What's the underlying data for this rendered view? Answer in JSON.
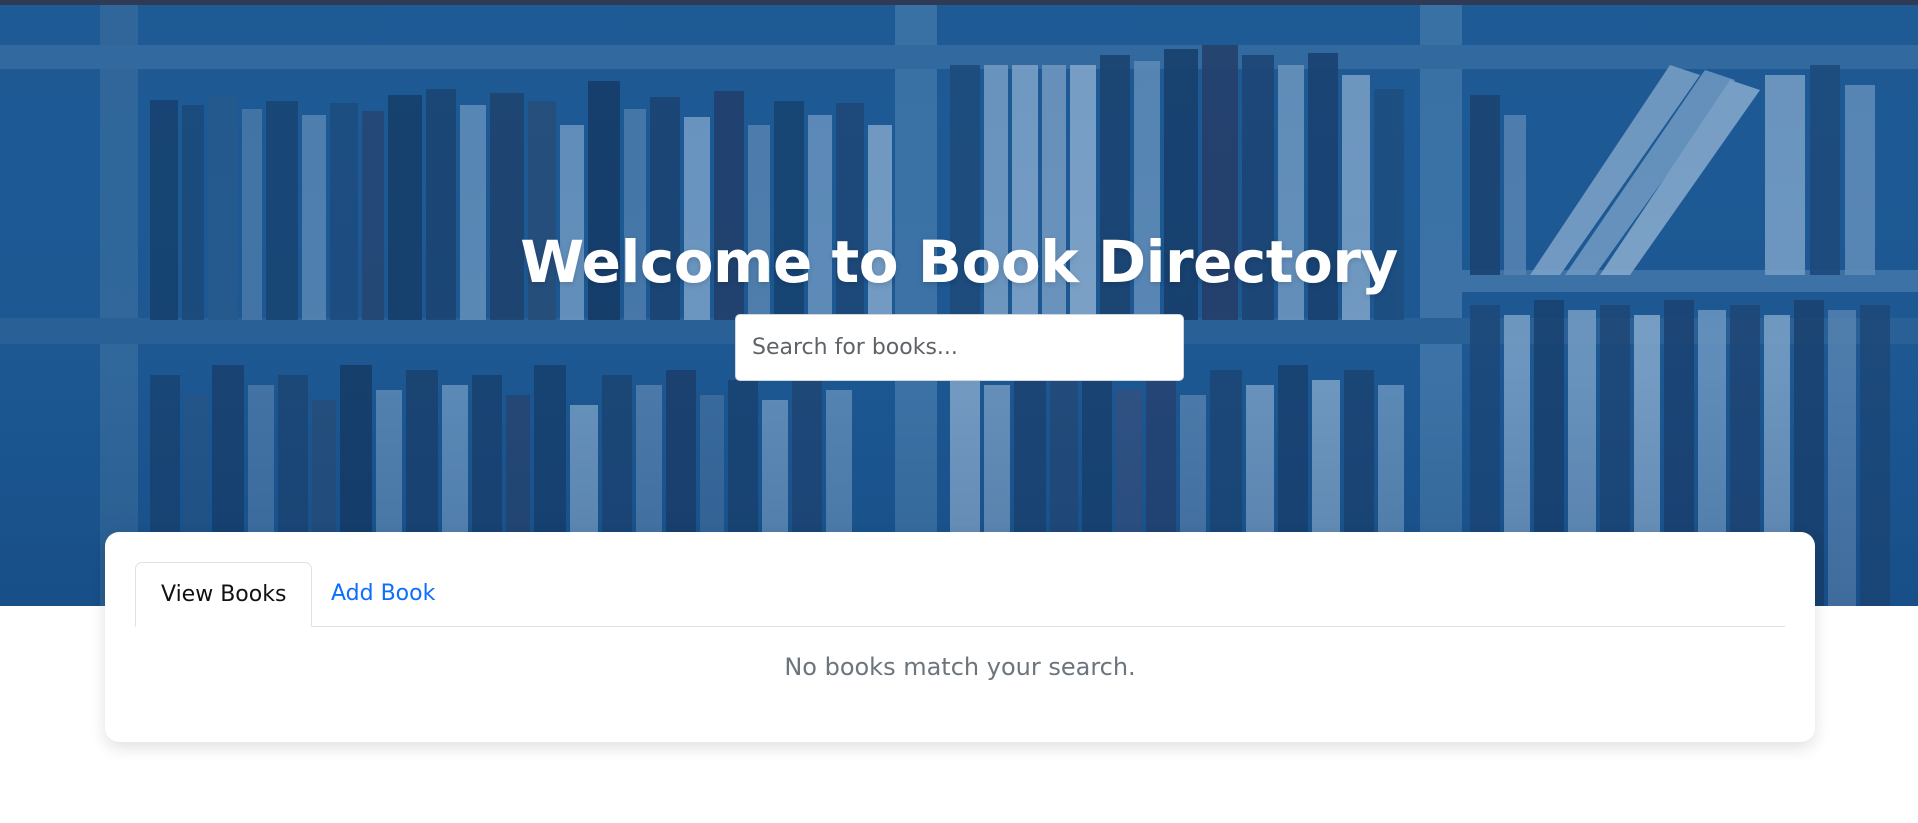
{
  "hero": {
    "title": "Welcome to Book Directory",
    "search_placeholder": "Search for books..."
  },
  "tabs": {
    "items": [
      {
        "label": "View Books",
        "active": true
      },
      {
        "label": "Add Book",
        "active": false
      }
    ]
  },
  "books": {
    "empty_message": "No books match your search."
  },
  "colors": {
    "hero_blue": "#2b6aa0",
    "link_blue": "#0d6efd",
    "muted_text": "#6c757d"
  }
}
